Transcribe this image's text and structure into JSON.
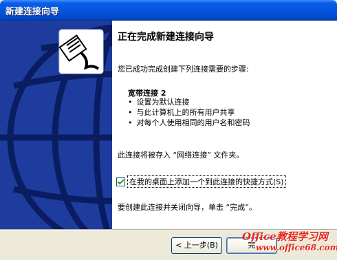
{
  "window": {
    "title": "新建连接向导"
  },
  "main": {
    "heading": "正在完成新建连接向导",
    "intro": "您已成功完成创建下列连接需要的步骤:",
    "connection_name": "宽带连接 2",
    "steps": [
      "设置为默认连接",
      "与此计算机上的所有用户共享",
      "对每个人使用相同的用户名和密码"
    ],
    "store_note": "此连接将被存入 “网络连接” 文件夹。",
    "shortcut_checkbox": {
      "label": "在我的桌面上添加一个到此连接的快捷方式(S)",
      "checked": true
    },
    "finish_note": "要创建此连接并关闭向导，单击 “完成”。"
  },
  "buttons": {
    "back": "< 上一步(B)",
    "finish": "完"
  },
  "watermark": {
    "line1": "Office教程学习网",
    "line2": "www.office68.com"
  },
  "colors": {
    "titlebar": "#0454dc",
    "left_panel": "#1e3c9e",
    "watermark": "#e52a1e"
  },
  "icons": {
    "wizard": "network-cable-plug-icon",
    "decor": "globe-grid"
  }
}
